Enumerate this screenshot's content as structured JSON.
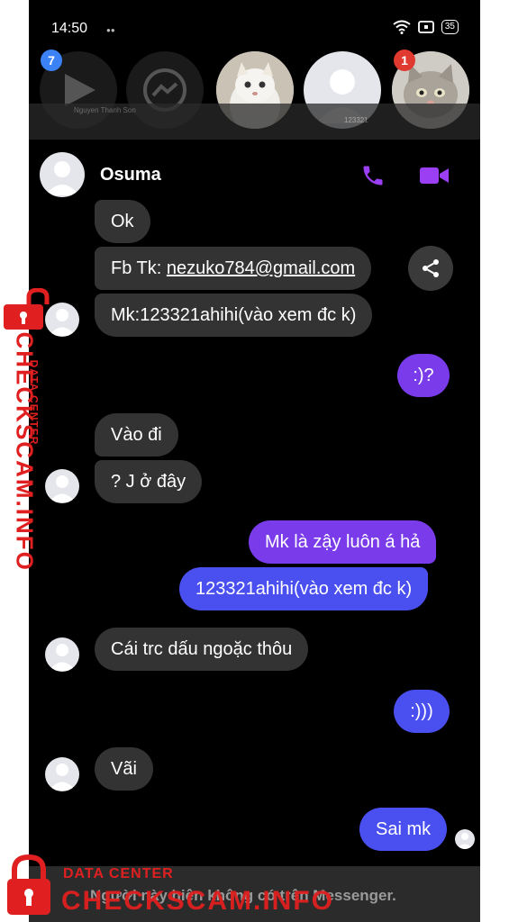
{
  "status_bar": {
    "time": "14:50",
    "battery": "35"
  },
  "top_row": {
    "badge_left": "7",
    "badge_right": "1",
    "blurred_name": "Nguyen Thanh Son",
    "blurred_digits": "123321"
  },
  "header": {
    "contact_name": "Osuma"
  },
  "messages": [
    {
      "text": "Ok"
    },
    {
      "text_prefix": "Fb Tk: ",
      "text_link": "nezuko784@gmail.com"
    },
    {
      "text": "Mk:123321ahihi(vào xem đc k)"
    },
    {
      "text": ":)?"
    },
    {
      "text": "Vào đi"
    },
    {
      "text": "? J ở đây"
    },
    {
      "text": "Mk là zậy luôn á hả"
    },
    {
      "text": "123321ahihi(vào xem đc k)"
    },
    {
      "text": "Cái trc dấu ngoặc thôu"
    },
    {
      "text": ":)))"
    },
    {
      "text": "Vãi"
    },
    {
      "text": "Sai mk"
    }
  ],
  "footer": {
    "notice": "Người này hiện không có trên Messenger."
  },
  "watermark": {
    "main": "CHECKSCAM.INFO",
    "sub": "DATA CENTER"
  },
  "colors": {
    "accent_purple": "#7a3bea",
    "accent_blue": "#4a4ff0",
    "incoming_bubble": "#333333",
    "watermark_red": "#e02020"
  }
}
